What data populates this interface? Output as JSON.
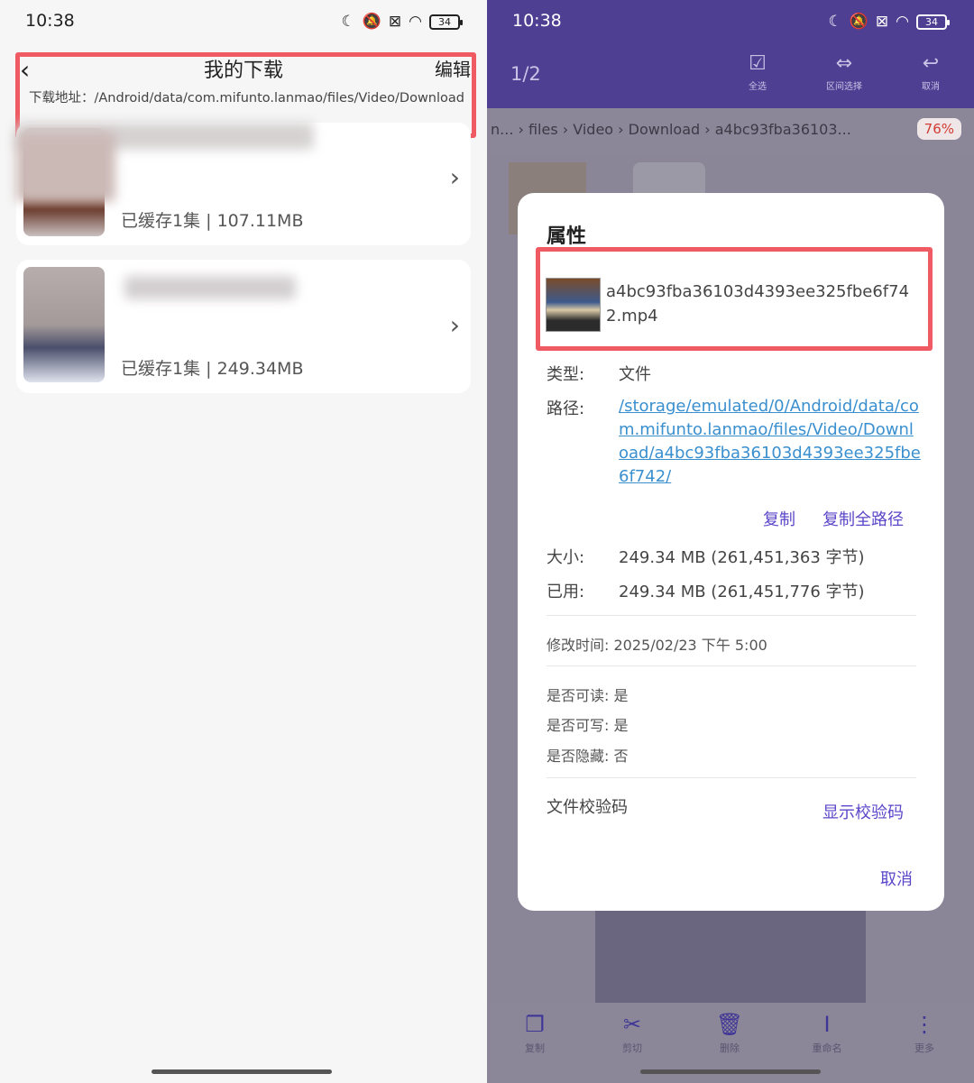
{
  "left": {
    "status": {
      "time": "10:38",
      "battery": "34"
    },
    "header": {
      "title": "我的下载",
      "edit": "编辑",
      "path": "下载地址：/Android/data/com.mifunto.lanmao/files/Video/Download"
    },
    "items": [
      {
        "cached": "已缓存1集 | 107.11MB"
      },
      {
        "cached": "已缓存1集 | 249.34MB"
      }
    ]
  },
  "right": {
    "status": {
      "time": "10:38",
      "battery": "34"
    },
    "pager": "1/2",
    "toolbar": [
      {
        "label": "全选"
      },
      {
        "label": "区间选择"
      },
      {
        "label": "取消"
      }
    ],
    "breadcrumb": "n... › files › Video › Download › a4bc93fba36103...",
    "storage_pct": "76%",
    "bottom_toolbar": [
      {
        "label": "复制"
      },
      {
        "label": "剪切"
      },
      {
        "label": "删除"
      },
      {
        "label": "重命名"
      },
      {
        "label": "更多"
      }
    ],
    "dialog": {
      "title": "属性",
      "filename": "a4bc93fba36103d4393ee325fbe6f742.mp4",
      "type_label": "类型:",
      "type_value": "文件",
      "path_label": "路径:",
      "path_value": "/storage/emulated/0/Android/data/com.mifunto.lanmao/files/Video/Download/a4bc93fba36103d4393ee325fbe6f742/",
      "copy": "复制",
      "copy_full_path": "复制全路径",
      "size_label": "大小:",
      "size_value": "249.34 MB (261,451,363 字节)",
      "used_label": "已用:",
      "used_value": "249.34 MB (261,451,776 字节)",
      "modified": "修改时间: 2025/02/23 下午 5:00",
      "readable": "是否可读: 是",
      "writable": "是否可写: 是",
      "hidden": "是否隐藏: 否",
      "checksum_label": "文件校验码",
      "show_checksum": "显示校验码",
      "cancel": "取消"
    }
  }
}
